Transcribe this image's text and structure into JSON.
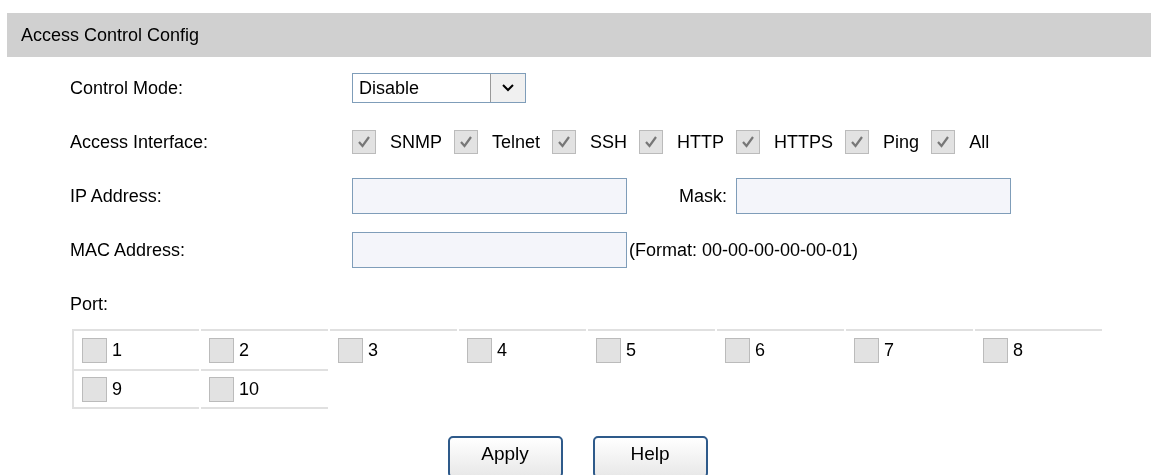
{
  "header": {
    "title": "Access Control Config"
  },
  "control_mode": {
    "label": "Control Mode:",
    "value": "Disable"
  },
  "access_interface": {
    "label": "Access Interface:",
    "options": [
      {
        "label": "SNMP",
        "checked": true,
        "disabled": true
      },
      {
        "label": "Telnet",
        "checked": true,
        "disabled": true
      },
      {
        "label": "SSH",
        "checked": true,
        "disabled": true
      },
      {
        "label": "HTTP",
        "checked": true,
        "disabled": true
      },
      {
        "label": "HTTPS",
        "checked": true,
        "disabled": true
      },
      {
        "label": "Ping",
        "checked": true,
        "disabled": true
      },
      {
        "label": "All",
        "checked": true,
        "disabled": true
      }
    ]
  },
  "ip_address": {
    "label": "IP Address:",
    "mask_label": "Mask:"
  },
  "mac_address": {
    "label": "MAC Address:",
    "hint": "(Format: 00-00-00-00-00-01)"
  },
  "port": {
    "label": "Port:",
    "ports": [
      {
        "label": "1",
        "checked": false,
        "disabled": true
      },
      {
        "label": "2",
        "checked": false,
        "disabled": true
      },
      {
        "label": "3",
        "checked": false,
        "disabled": true
      },
      {
        "label": "4",
        "checked": false,
        "disabled": true
      },
      {
        "label": "5",
        "checked": false,
        "disabled": true
      },
      {
        "label": "6",
        "checked": false,
        "disabled": true
      },
      {
        "label": "7",
        "checked": false,
        "disabled": true
      },
      {
        "label": "8",
        "checked": false,
        "disabled": true
      },
      {
        "label": "9",
        "checked": false,
        "disabled": true
      },
      {
        "label": "10",
        "checked": false,
        "disabled": true
      }
    ]
  },
  "buttons": [
    "Apply",
    "Help"
  ]
}
